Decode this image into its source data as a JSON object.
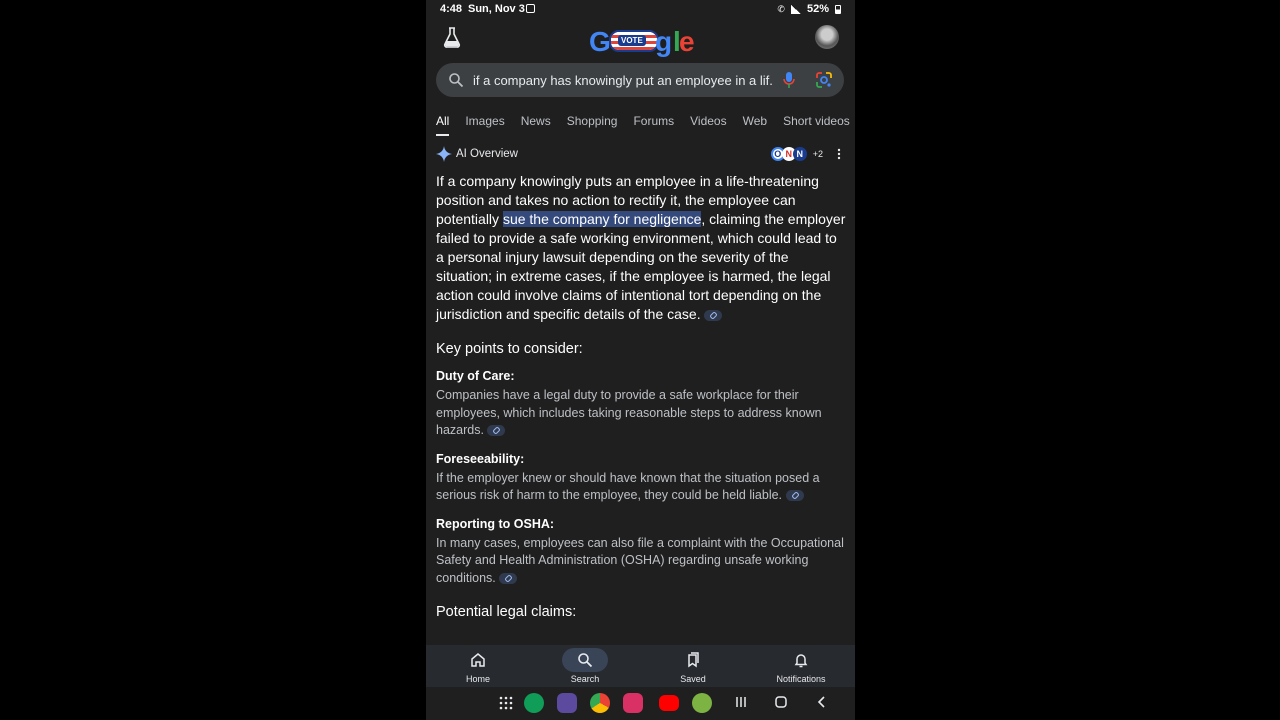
{
  "status": {
    "time": "4:48",
    "date": "Sun, Nov 3",
    "battery": "52%"
  },
  "logo": {
    "text_left": "G",
    "ballot_text": "VOTE",
    "text_right": "g",
    "text_l": "l",
    "text_e": "e"
  },
  "search": {
    "query": "if a company has knowingly put an employee in a lif..."
  },
  "tabs": [
    "All",
    "Images",
    "News",
    "Shopping",
    "Forums",
    "Videos",
    "Web",
    "Short videos"
  ],
  "ai_overview": {
    "label": "AI Overview",
    "sources_extra": "+2",
    "source_icons": [
      "O",
      "N",
      "N"
    ],
    "lead_before": "If a company knowingly puts an employee in a life-threatening position and takes no action to rectify it, the employee can potentially ",
    "lead_highlight": "sue the company for negligence",
    "lead_after": ", claiming the employer failed to provide a safe working environment, which could lead to a personal injury lawsuit depending on the severity of the situation; in extreme cases, if the employee is harmed, the legal action could involve claims of intentional tort depending on the jurisdiction and specific details of the case.",
    "key_points_heading": "Key points to consider:",
    "points": [
      {
        "title": "Duty of Care:",
        "text": "Companies have a legal duty to provide a safe workplace for their employees, which includes taking reasonable steps to address known hazards."
      },
      {
        "title": "Foreseeability:",
        "text": "If the employer knew or should have known that the situation posed a serious risk of harm to the employee, they could be held liable."
      },
      {
        "title": "Reporting to OSHA:",
        "text": "In many cases, employees can also file a complaint with the Occupational Safety and Health Administration (OSHA) regarding unsafe working conditions."
      }
    ],
    "next_heading": "Potential legal claims:"
  },
  "bottom_nav": {
    "home": "Home",
    "search": "Search",
    "saved": "Saved",
    "notifications": "Notifications"
  },
  "colors": {
    "background": "#1f1f1f",
    "highlight": "#344a7c",
    "search_box": "#3c4043",
    "accent_blue": "#4285f4"
  }
}
